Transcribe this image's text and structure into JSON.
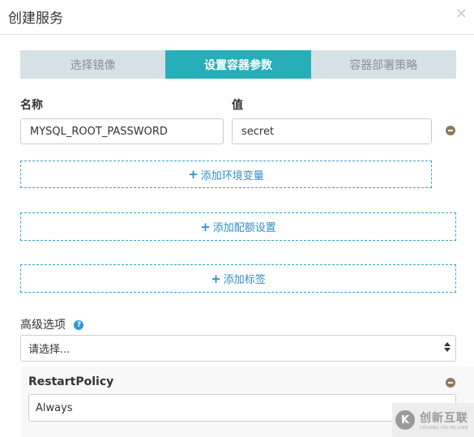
{
  "dialog": {
    "title": "创建服务",
    "close_icon": "×"
  },
  "tabs": [
    {
      "label": "选择镜像",
      "active": false
    },
    {
      "label": "设置容器参数",
      "active": true
    },
    {
      "label": "容器部署策略",
      "active": false
    }
  ],
  "env": {
    "name_label": "名称",
    "value_label": "值",
    "name_value": "MYSQL_ROOT_PASSWORD",
    "value_value": "secret"
  },
  "buttons": {
    "add_env": "添加环境变量",
    "add_quota": "添加配额设置",
    "add_label": "添加标签",
    "plus_icon": "+"
  },
  "advanced": {
    "label": "高级选项",
    "help_icon": "?",
    "select_value": "请选择..."
  },
  "restart_policy": {
    "label": "RestartPolicy",
    "value": "Always"
  },
  "watermark": {
    "logo_text": "K",
    "main": "创新互联",
    "sub": "CHUANG XIN HU LIAN"
  },
  "colors": {
    "accent_teal": "#27aeb8",
    "tab_inactive": "#d6e1e6",
    "link_blue": "#2f8fc9",
    "remove_icon": "#8b7c5c"
  }
}
